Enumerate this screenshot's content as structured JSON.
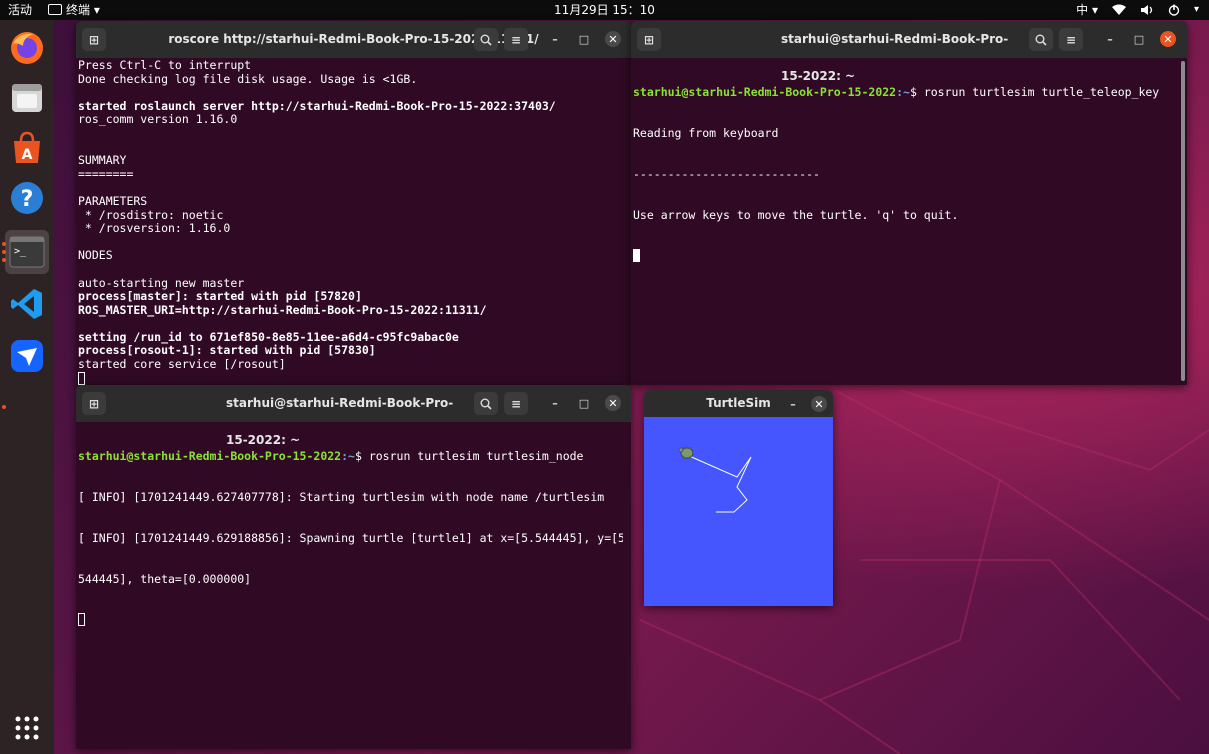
{
  "topbar": {
    "activities": "活动",
    "app_menu": "终端 ▾",
    "clock": "11月29日 15：10",
    "input_method": "中 ▾",
    "status_icons": [
      "wifi-icon",
      "volume-icon",
      "power-icon"
    ]
  },
  "dock": {
    "apps": [
      "firefox",
      "files",
      "software",
      "help",
      "terminal",
      "vscode",
      "feishu"
    ],
    "show_apps": "grid"
  },
  "windows": {
    "roscore": {
      "title": "roscore http://starhui-Redmi-Book-Pro-15-2022:11311/",
      "lines": [
        {
          "t": "Press Ctrl-C to interrupt"
        },
        {
          "t": "Done checking log file disk usage. Usage is <1GB."
        },
        {
          "t": ""
        },
        {
          "t": "started roslaunch server http://starhui-Redmi-Book-Pro-15-2022:37403/",
          "b": true
        },
        {
          "t": "ros_comm version 1.16.0"
        },
        {
          "t": ""
        },
        {
          "t": ""
        },
        {
          "t": "SUMMARY"
        },
        {
          "t": "========"
        },
        {
          "t": ""
        },
        {
          "t": "PARAMETERS"
        },
        {
          "t": " * /rosdistro: noetic"
        },
        {
          "t": " * /rosversion: 1.16.0"
        },
        {
          "t": ""
        },
        {
          "t": "NODES"
        },
        {
          "t": ""
        },
        {
          "t": "auto-starting new master"
        },
        {
          "t": "process[master]: started with pid [57820]",
          "b": true
        },
        {
          "t": "ROS_MASTER_URI=http://starhui-Redmi-Book-Pro-15-2022:11311/",
          "b": true
        },
        {
          "t": ""
        },
        {
          "t": "setting /run_id to 671ef850-8e85-11ee-a6d4-c95fc9abac0e",
          "b": true
        },
        {
          "t": "process[rosout-1]: started with pid [57830]",
          "b": true
        },
        {
          "t": "started core service [/rosout]"
        }
      ]
    },
    "teleop": {
      "title": "starhui@starhui-Redmi-Book-Pro-15-2022: ~",
      "prompt_user": "starhui@starhui-Redmi-Book-Pro-15-2022",
      "prompt_path": ":~",
      "prompt_sym": "$ ",
      "command": "rosrun turtlesim turtle_teleop_key",
      "lines": [
        "Reading from keyboard",
        "---------------------------",
        "Use arrow keys to move the turtle. 'q' to quit."
      ]
    },
    "turtlesim_node": {
      "title": "starhui@starhui-Redmi-Book-Pro-15-2022: ~",
      "prompt_user": "starhui@starhui-Redmi-Book-Pro-15-2022",
      "prompt_path": ":~",
      "prompt_sym": "$ ",
      "command": "rosrun turtlesim turtlesim_node",
      "lines": [
        "[ INFO] [1701241449.627407778]: Starting turtlesim with node name /turtlesim",
        "[ INFO] [1701241449.629188856]: Spawning turtle [turtle1] at x=[5.544445], y=[5.",
        "544445], theta=[0.000000]"
      ]
    },
    "turtlesim": {
      "title": "TurtleSim",
      "background": "#4556ff"
    }
  },
  "buttons": {
    "search": "🔍",
    "menu": "≡",
    "minimize": "–",
    "maximize": "□",
    "close": "✕",
    "newtab": "⊞"
  }
}
